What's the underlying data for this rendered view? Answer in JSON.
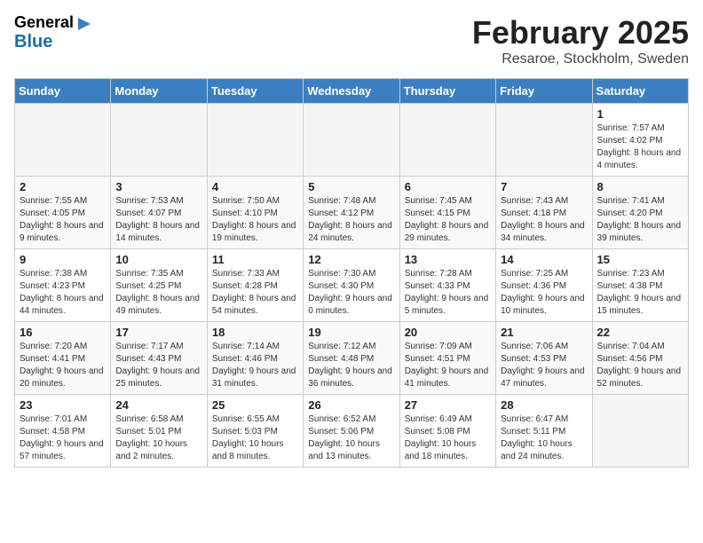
{
  "logo": {
    "line1": "General",
    "line2": "Blue"
  },
  "title": "February 2025",
  "location": "Resaroe, Stockholm, Sweden",
  "days_of_week": [
    "Sunday",
    "Monday",
    "Tuesday",
    "Wednesday",
    "Thursday",
    "Friday",
    "Saturday"
  ],
  "weeks": [
    [
      {
        "day": "",
        "info": ""
      },
      {
        "day": "",
        "info": ""
      },
      {
        "day": "",
        "info": ""
      },
      {
        "day": "",
        "info": ""
      },
      {
        "day": "",
        "info": ""
      },
      {
        "day": "",
        "info": ""
      },
      {
        "day": "1",
        "info": "Sunrise: 7:57 AM\nSunset: 4:02 PM\nDaylight: 8 hours and 4 minutes."
      }
    ],
    [
      {
        "day": "2",
        "info": "Sunrise: 7:55 AM\nSunset: 4:05 PM\nDaylight: 8 hours and 9 minutes."
      },
      {
        "day": "3",
        "info": "Sunrise: 7:53 AM\nSunset: 4:07 PM\nDaylight: 8 hours and 14 minutes."
      },
      {
        "day": "4",
        "info": "Sunrise: 7:50 AM\nSunset: 4:10 PM\nDaylight: 8 hours and 19 minutes."
      },
      {
        "day": "5",
        "info": "Sunrise: 7:48 AM\nSunset: 4:12 PM\nDaylight: 8 hours and 24 minutes."
      },
      {
        "day": "6",
        "info": "Sunrise: 7:45 AM\nSunset: 4:15 PM\nDaylight: 8 hours and 29 minutes."
      },
      {
        "day": "7",
        "info": "Sunrise: 7:43 AM\nSunset: 4:18 PM\nDaylight: 8 hours and 34 minutes."
      },
      {
        "day": "8",
        "info": "Sunrise: 7:41 AM\nSunset: 4:20 PM\nDaylight: 8 hours and 39 minutes."
      }
    ],
    [
      {
        "day": "9",
        "info": "Sunrise: 7:38 AM\nSunset: 4:23 PM\nDaylight: 8 hours and 44 minutes."
      },
      {
        "day": "10",
        "info": "Sunrise: 7:35 AM\nSunset: 4:25 PM\nDaylight: 8 hours and 49 minutes."
      },
      {
        "day": "11",
        "info": "Sunrise: 7:33 AM\nSunset: 4:28 PM\nDaylight: 8 hours and 54 minutes."
      },
      {
        "day": "12",
        "info": "Sunrise: 7:30 AM\nSunset: 4:30 PM\nDaylight: 9 hours and 0 minutes."
      },
      {
        "day": "13",
        "info": "Sunrise: 7:28 AM\nSunset: 4:33 PM\nDaylight: 9 hours and 5 minutes."
      },
      {
        "day": "14",
        "info": "Sunrise: 7:25 AM\nSunset: 4:36 PM\nDaylight: 9 hours and 10 minutes."
      },
      {
        "day": "15",
        "info": "Sunrise: 7:23 AM\nSunset: 4:38 PM\nDaylight: 9 hours and 15 minutes."
      }
    ],
    [
      {
        "day": "16",
        "info": "Sunrise: 7:20 AM\nSunset: 4:41 PM\nDaylight: 9 hours and 20 minutes."
      },
      {
        "day": "17",
        "info": "Sunrise: 7:17 AM\nSunset: 4:43 PM\nDaylight: 9 hours and 25 minutes."
      },
      {
        "day": "18",
        "info": "Sunrise: 7:14 AM\nSunset: 4:46 PM\nDaylight: 9 hours and 31 minutes."
      },
      {
        "day": "19",
        "info": "Sunrise: 7:12 AM\nSunset: 4:48 PM\nDaylight: 9 hours and 36 minutes."
      },
      {
        "day": "20",
        "info": "Sunrise: 7:09 AM\nSunset: 4:51 PM\nDaylight: 9 hours and 41 minutes."
      },
      {
        "day": "21",
        "info": "Sunrise: 7:06 AM\nSunset: 4:53 PM\nDaylight: 9 hours and 47 minutes."
      },
      {
        "day": "22",
        "info": "Sunrise: 7:04 AM\nSunset: 4:56 PM\nDaylight: 9 hours and 52 minutes."
      }
    ],
    [
      {
        "day": "23",
        "info": "Sunrise: 7:01 AM\nSunset: 4:58 PM\nDaylight: 9 hours and 57 minutes."
      },
      {
        "day": "24",
        "info": "Sunrise: 6:58 AM\nSunset: 5:01 PM\nDaylight: 10 hours and 2 minutes."
      },
      {
        "day": "25",
        "info": "Sunrise: 6:55 AM\nSunset: 5:03 PM\nDaylight: 10 hours and 8 minutes."
      },
      {
        "day": "26",
        "info": "Sunrise: 6:52 AM\nSunset: 5:06 PM\nDaylight: 10 hours and 13 minutes."
      },
      {
        "day": "27",
        "info": "Sunrise: 6:49 AM\nSunset: 5:08 PM\nDaylight: 10 hours and 18 minutes."
      },
      {
        "day": "28",
        "info": "Sunrise: 6:47 AM\nSunset: 5:11 PM\nDaylight: 10 hours and 24 minutes."
      },
      {
        "day": "",
        "info": ""
      }
    ]
  ]
}
